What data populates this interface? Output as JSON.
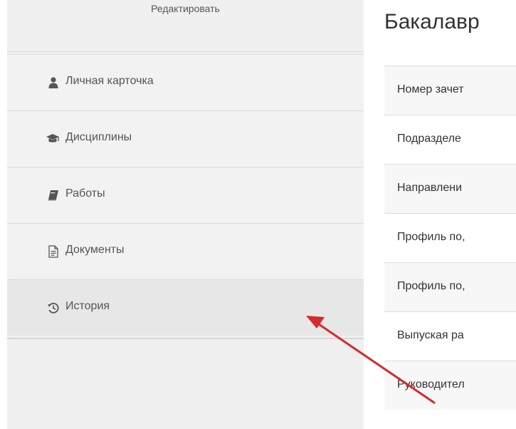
{
  "sidebar": {
    "edit_label": "Редактировать",
    "items": [
      {
        "label": "Личная карточка",
        "icon": "user-icon"
      },
      {
        "label": "Дисциплины",
        "icon": "graduation-cap-icon"
      },
      {
        "label": "Работы",
        "icon": "book-icon"
      },
      {
        "label": "Документы",
        "icon": "document-icon"
      },
      {
        "label": "История",
        "icon": "history-icon"
      }
    ],
    "active_item": "История"
  },
  "main": {
    "title": "Бакалавр",
    "rows": [
      {
        "label": "Номер зачет"
      },
      {
        "label": "Подразделе"
      },
      {
        "label": "Направлени"
      },
      {
        "label": "Профиль по,"
      },
      {
        "label": "Профиль по,"
      },
      {
        "label": "Выпуская ра"
      },
      {
        "label": "Руководител"
      }
    ]
  },
  "colors": {
    "sidebar_bg": "#f0f0f0",
    "active_bg": "#e7e7e7",
    "annotation_arrow": "#d42a2a",
    "text": "#555555"
  }
}
